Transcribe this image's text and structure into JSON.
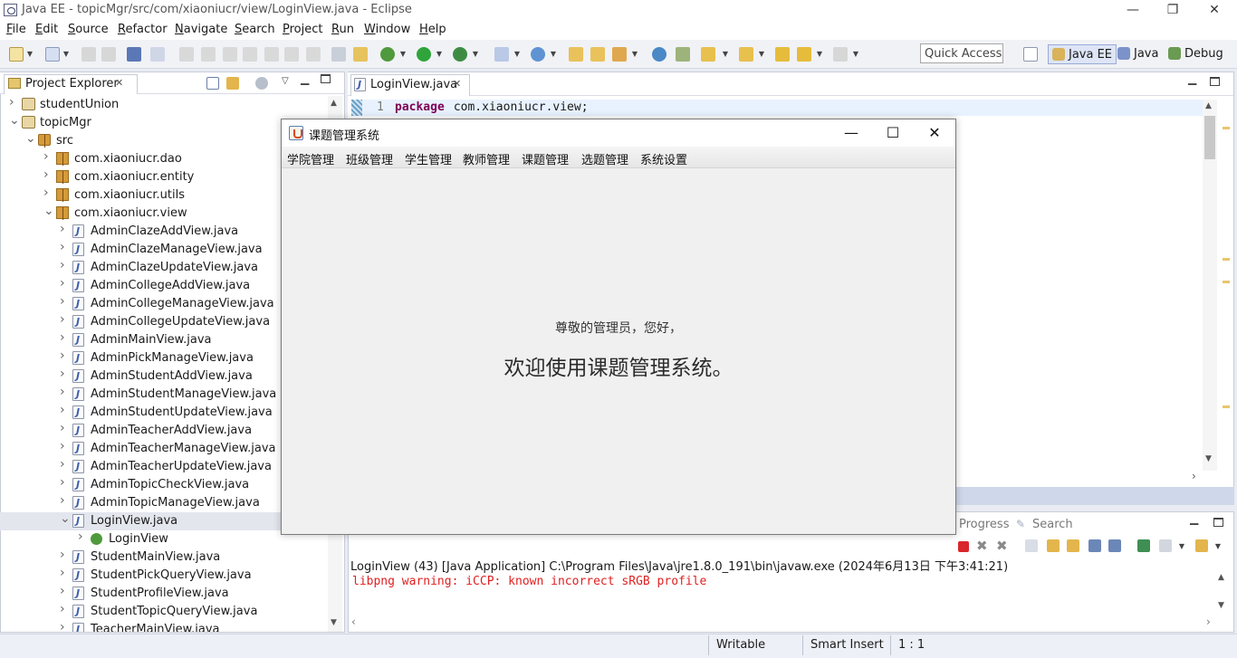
{
  "window": {
    "title": "Java EE - topicMgr/src/com/xiaoniucr/view/LoginView.java - Eclipse",
    "minimize": "—",
    "restore": "❐",
    "close": "✕"
  },
  "menu": [
    "File",
    "Edit",
    "Source",
    "Refactor",
    "Navigate",
    "Search",
    "Project",
    "Run",
    "Window",
    "Help"
  ],
  "toolbar": {
    "quick_access_placeholder": "Quick Access",
    "perspectives": [
      "Java EE",
      "Java",
      "Debug"
    ]
  },
  "project_explorer": {
    "tab_label": "Project Explorer",
    "tab_close": "✕",
    "tree": [
      {
        "label": "studentUnion",
        "level": 0,
        "kind": "project",
        "expanded": false
      },
      {
        "label": "topicMgr",
        "level": 0,
        "kind": "project",
        "expanded": true
      },
      {
        "label": "src",
        "level": 1,
        "kind": "srcfolder",
        "expanded": true
      },
      {
        "label": "com.xiaoniucr.dao",
        "level": 2,
        "kind": "package",
        "expanded": false
      },
      {
        "label": "com.xiaoniucr.entity",
        "level": 2,
        "kind": "package",
        "expanded": false
      },
      {
        "label": "com.xiaoniucr.utils",
        "level": 2,
        "kind": "package",
        "expanded": false
      },
      {
        "label": "com.xiaoniucr.view",
        "level": 2,
        "kind": "package",
        "expanded": true
      },
      {
        "label": "AdminClazeAddView.java",
        "level": 3,
        "kind": "java"
      },
      {
        "label": "AdminClazeManageView.java",
        "level": 3,
        "kind": "java"
      },
      {
        "label": "AdminClazeUpdateView.java",
        "level": 3,
        "kind": "java"
      },
      {
        "label": "AdminCollegeAddView.java",
        "level": 3,
        "kind": "java"
      },
      {
        "label": "AdminCollegeManageView.java",
        "level": 3,
        "kind": "java"
      },
      {
        "label": "AdminCollegeUpdateView.java",
        "level": 3,
        "kind": "java"
      },
      {
        "label": "AdminMainView.java",
        "level": 3,
        "kind": "java"
      },
      {
        "label": "AdminPickManageView.java",
        "level": 3,
        "kind": "java"
      },
      {
        "label": "AdminStudentAddView.java",
        "level": 3,
        "kind": "java"
      },
      {
        "label": "AdminStudentManageView.java",
        "level": 3,
        "kind": "java"
      },
      {
        "label": "AdminStudentUpdateView.java",
        "level": 3,
        "kind": "java"
      },
      {
        "label": "AdminTeacherAddView.java",
        "level": 3,
        "kind": "java"
      },
      {
        "label": "AdminTeacherManageView.java",
        "level": 3,
        "kind": "java"
      },
      {
        "label": "AdminTeacherUpdateView.java",
        "level": 3,
        "kind": "java"
      },
      {
        "label": "AdminTopicCheckView.java",
        "level": 3,
        "kind": "java"
      },
      {
        "label": "AdminTopicManageView.java",
        "level": 3,
        "kind": "java"
      },
      {
        "label": "LoginView.java",
        "level": 3,
        "kind": "java",
        "selected": true,
        "expanded": true
      },
      {
        "label": "LoginView",
        "level": 4,
        "kind": "class"
      },
      {
        "label": "StudentMainView.java",
        "level": 3,
        "kind": "java"
      },
      {
        "label": "StudentPickQueryView.java",
        "level": 3,
        "kind": "java"
      },
      {
        "label": "StudentProfileView.java",
        "level": 3,
        "kind": "java"
      },
      {
        "label": "StudentTopicQueryView.java",
        "level": 3,
        "kind": "java"
      },
      {
        "label": "TeacherMainView.java",
        "level": 3,
        "kind": "java"
      }
    ]
  },
  "editor": {
    "tab_label": "LoginView.java",
    "tab_close": "✕",
    "line_number": "1",
    "keyword": "package",
    "code_rest": " com.xiaoniucr.view;"
  },
  "console": {
    "tabs": [
      "Progress",
      "Search"
    ],
    "process_line": "LoginView (43) [Java Application] C:\\Program Files\\Java\\jre1.8.0_191\\bin\\javaw.exe (2024年6月13日 下午3:41:21)",
    "error_line": "libpng warning: iCCP: known incorrect sRGB profile"
  },
  "status_bar": {
    "writable": "Writable",
    "insert_mode": "Smart Insert",
    "position": "1 : 1"
  },
  "dialog": {
    "title": "课题管理系统",
    "minimize": "—",
    "maximize": "☐",
    "close": "✕",
    "menus": [
      "学院管理",
      "班级管理",
      "学生管理",
      "教师管理",
      "课题管理",
      "选题管理",
      "系统设置"
    ],
    "greeting": "尊敬的管理员，您好，",
    "welcome": "欢迎使用课题管理系统。"
  },
  "colors": {
    "keyword": "#7f0055",
    "error": "#e02020",
    "selection": "#e4e6ee",
    "highlight_line": "#e8f2fe"
  }
}
